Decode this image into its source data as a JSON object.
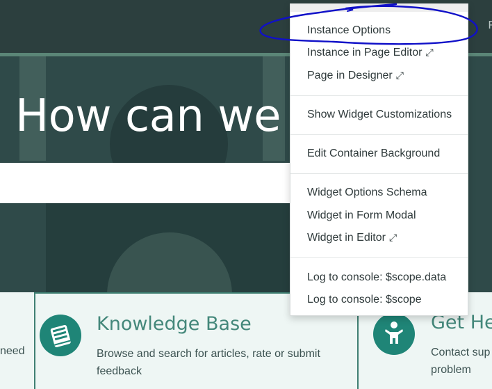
{
  "header": {
    "partial_right_text": "R"
  },
  "hero": {
    "title": "How can we h"
  },
  "search": {
    "value": ""
  },
  "cards": {
    "left_partial_text": "need",
    "knowledge_base": {
      "icon": "book-icon",
      "title": "Knowledge Base",
      "description_line1": "Browse and search for articles, rate or submit",
      "description_line2": "feedback"
    },
    "get_help": {
      "icon": "person-icon",
      "title": "Get Hel",
      "description_line1": "Contact sup",
      "description_line2": "problem"
    }
  },
  "dropdown": {
    "groups": [
      {
        "items": [
          {
            "label": "Instance Options",
            "external": false
          },
          {
            "label": "Instance in Page Editor",
            "external": true
          },
          {
            "label": "Page in Designer",
            "external": true
          }
        ]
      },
      {
        "items": [
          {
            "label": "Show Widget Customizations",
            "external": false
          }
        ]
      },
      {
        "items": [
          {
            "label": "Edit Container Background",
            "external": false
          }
        ]
      },
      {
        "items": [
          {
            "label": "Widget Options Schema",
            "external": false
          },
          {
            "label": "Widget in Form Modal",
            "external": false
          },
          {
            "label": "Widget in Editor",
            "external": true
          }
        ]
      },
      {
        "items": [
          {
            "label": "Log to console: $scope.data",
            "external": false
          },
          {
            "label": "Log to console: $scope",
            "external": false
          }
        ]
      }
    ],
    "external_glyph": "⤢"
  },
  "colors": {
    "hero_bg": "#2f4a49",
    "topbar_bg": "#2c3f3e",
    "accent_teal": "#1f8577",
    "card_title": "#43877a",
    "annotation_ink": "#1010c8"
  }
}
